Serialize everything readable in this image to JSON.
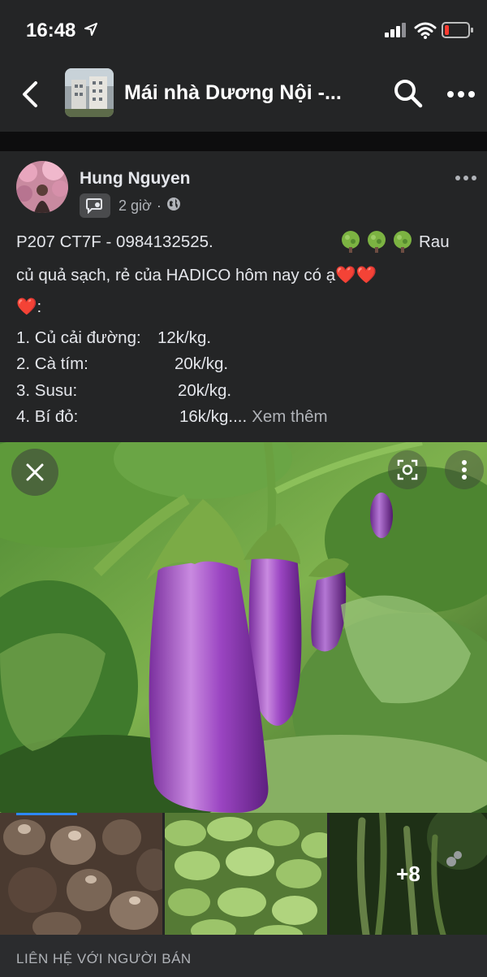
{
  "status_bar": {
    "time": "16:48",
    "icons": [
      "location-arrow-icon",
      "signal-icon",
      "wifi-icon",
      "battery-low-icon"
    ],
    "battery_color": "#ff3b30"
  },
  "header": {
    "title": "Mái nhà Dương Nội -...",
    "icons": [
      "back-icon",
      "search-icon",
      "more-icon"
    ]
  },
  "post": {
    "author": "Hung Nguyen",
    "time": "2 giờ",
    "meta_separator": "·",
    "line1_text": "P207 CT7F - 0984132525.",
    "line1_suffix": "Rau",
    "line2_text": "củ quả sạch, rẻ của HADICO hôm nay có ạ",
    "line2_emoji": "❤️❤️",
    "line3_emoji": "❤️",
    "line3_text": ":",
    "items": [
      {
        "name": "1. Củ cải đường:",
        "price": "12k/kg."
      },
      {
        "name": "2. Cà tím:",
        "price": "20k/kg."
      },
      {
        "name": "3. Susu:",
        "price": "20k/kg."
      },
      {
        "name": "4. Bí đỏ:",
        "price": "16k/kg...."
      }
    ],
    "see_more": "Xem thêm",
    "extra_photos": "+8",
    "seller_link": "LIÊN HỆ VỚI NGƯỜI BÁN"
  },
  "colors": {
    "background": "#18191a",
    "card": "#242526",
    "text": "#e4e6eb",
    "secondary_text": "#b0b3b8",
    "accent": "#2d88ff"
  }
}
